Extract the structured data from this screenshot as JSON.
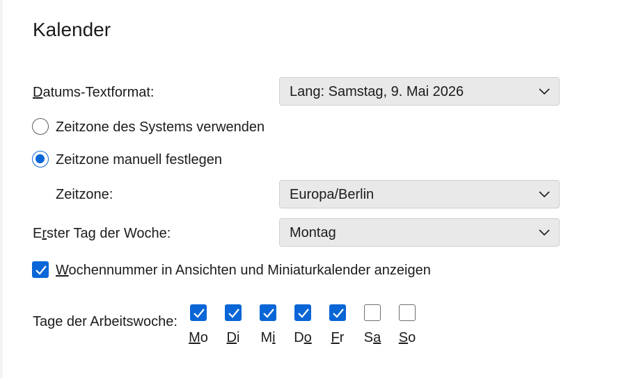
{
  "section": {
    "title": "Kalender"
  },
  "date_format": {
    "label_ak": "D",
    "label_rest": "atums-Textformat:",
    "value": "Lang: Samstag, 9. Mai 2026"
  },
  "timezone_mode": {
    "system_label": "Zeitzone des Systems verwenden",
    "manual_label": "Zeitzone manuell festlegen",
    "selected": "manual"
  },
  "timezone": {
    "label": "Zeitzone:",
    "value": "Europa/Berlin"
  },
  "first_day": {
    "label_pre": "E",
    "label_ak": "r",
    "label_rest": "ster Tag der Woche:",
    "value": "Montag"
  },
  "week_numbers": {
    "label_ak": "W",
    "label_rest": "ochennummer in Ansichten und Miniaturkalender anzeigen",
    "checked": true
  },
  "work_week": {
    "label": "Tage der Arbeitswoche:",
    "days": [
      {
        "pre": "",
        "ak": "M",
        "post": "o",
        "checked": true
      },
      {
        "pre": "",
        "ak": "D",
        "post": "i",
        "checked": true
      },
      {
        "pre": "M",
        "ak": "i",
        "post": "",
        "checked": true
      },
      {
        "pre": "D",
        "ak": "o",
        "post": "",
        "checked": true
      },
      {
        "pre": "",
        "ak": "F",
        "post": "r",
        "checked": true
      },
      {
        "pre": "S",
        "ak": "a",
        "post": "",
        "checked": false
      },
      {
        "pre": "",
        "ak": "S",
        "post": "o",
        "checked": false
      }
    ]
  },
  "colors": {
    "accent": "#0a66d6",
    "dropdown_bg": "#e9e9e9"
  },
  "icons": {
    "dropdown": "chevron-down-icon",
    "check": "checkmark-icon"
  }
}
